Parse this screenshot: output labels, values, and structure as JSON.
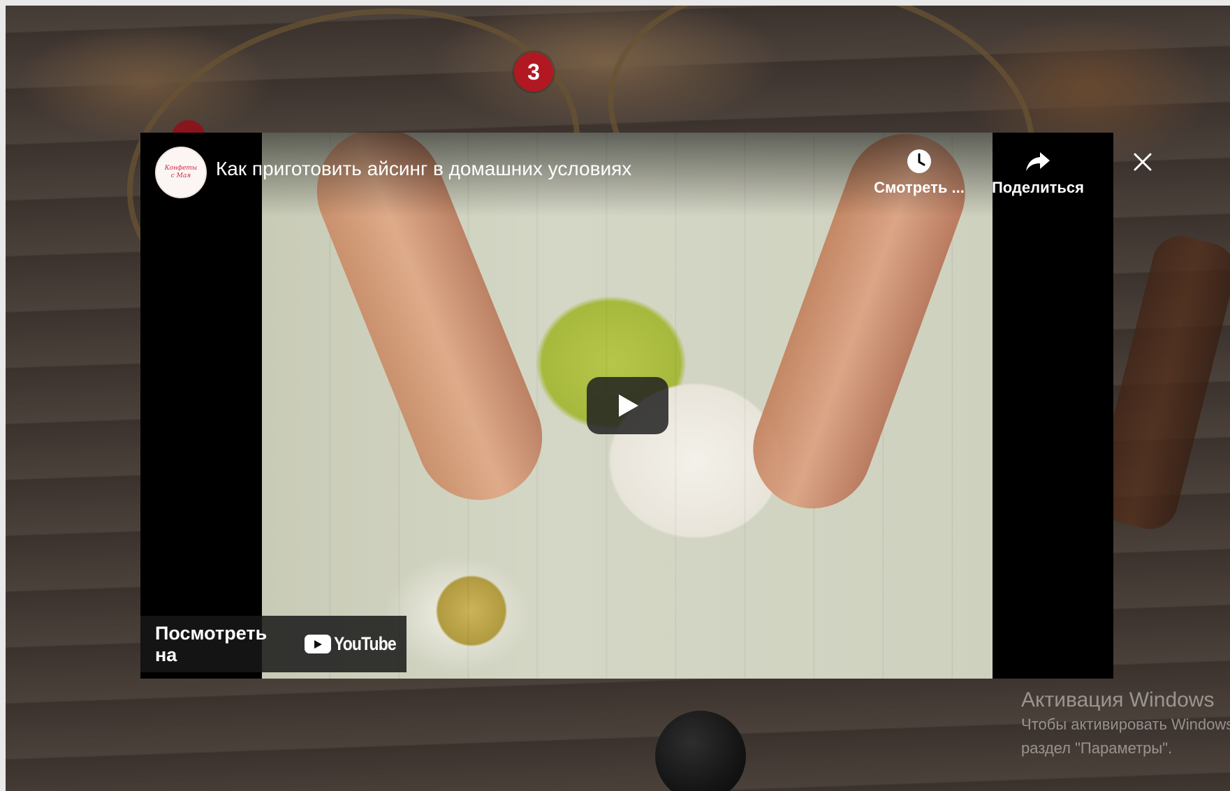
{
  "page": {
    "step_number": "3"
  },
  "video": {
    "title": "Как приготовить айсинг в домашних условиях",
    "channel_avatar_text": "Конфеты с Мая",
    "watch_later_label": "Смотреть ...",
    "share_label": "Поделиться",
    "watch_on_label": "Посмотреть на",
    "youtube_logo_text": "YouTube"
  },
  "watermark": {
    "title": "Активация Windows",
    "line1": "Чтобы активировать Windows, перейдите в",
    "line2": "раздел \"Параметры\"."
  },
  "colors": {
    "accent_red": "#b21822",
    "player_bg": "#000000",
    "button_bg": "#212121"
  },
  "icons": [
    "clock-icon",
    "share-icon",
    "play-icon",
    "youtube-play-icon",
    "close-icon"
  ]
}
